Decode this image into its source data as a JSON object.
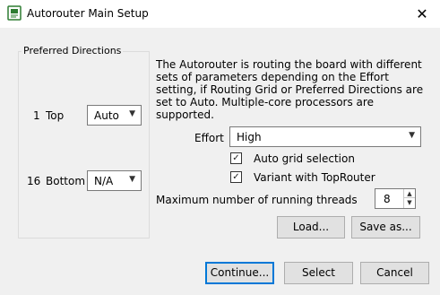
{
  "window": {
    "title": "Autorouter Main Setup",
    "close_glyph": "✕"
  },
  "preferred_directions": {
    "legend": "Preferred Directions",
    "layers": [
      {
        "number": "1",
        "name": "Top",
        "value": "Auto"
      },
      {
        "number": "16",
        "name": "Bottom",
        "value": "N/A"
      }
    ]
  },
  "description": "The Autorouter is routing the board with different sets of parameters depending on the Effort setting, if Routing Grid or Preferred Directions are set to Auto. Multiple-core processors are supported.",
  "effort": {
    "label": "Effort",
    "value": "High"
  },
  "options": [
    {
      "label": "Auto grid selection",
      "checked": true
    },
    {
      "label": "Variant with TopRouter",
      "checked": true
    }
  ],
  "threads": {
    "label": "Maximum number of running threads",
    "value": "8"
  },
  "buttons": {
    "load": "Load...",
    "save_as": "Save as...",
    "continue": "Continue...",
    "select": "Select",
    "cancel": "Cancel"
  },
  "colors": {
    "accent": "#0078d7",
    "background": "#f0f0f0",
    "icon_green": "#2e7d32"
  },
  "icons": {
    "app": "circuit-board-icon",
    "dropdown": "chevron-down-icon",
    "check": "checkmark-icon"
  }
}
